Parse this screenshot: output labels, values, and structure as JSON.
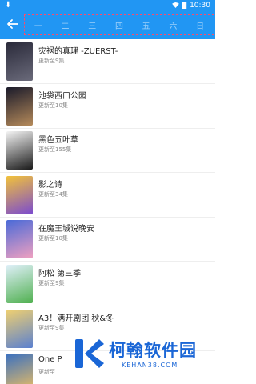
{
  "statusbar": {
    "time": "10:30"
  },
  "tabs": [
    "一",
    "二",
    "三",
    "四",
    "五",
    "六",
    "日"
  ],
  "list": [
    {
      "title": "灾祸的真理 -ZUERST-",
      "update": "更新至9集",
      "cover_colors": [
        "#2a2a3a",
        "#6a6a7a"
      ]
    },
    {
      "title": "池袋西口公园",
      "update": "更新至10集",
      "cover_colors": [
        "#1a1a2a",
        "#b58a5a"
      ]
    },
    {
      "title": "黑色五叶草",
      "update": "更新至155集",
      "cover_colors": [
        "#f4f4f4",
        "#1a1a1a"
      ]
    },
    {
      "title": "影之诗",
      "update": "更新至34集",
      "cover_colors": [
        "#f2c23a",
        "#7a4ad0"
      ]
    },
    {
      "title": "在魔王城说晚安",
      "update": "更新至10集",
      "cover_colors": [
        "#4a6ad8",
        "#f0a0c0"
      ]
    },
    {
      "title": "阿松 第三季",
      "update": "更新至9集",
      "cover_colors": [
        "#e0f0fa",
        "#50b050"
      ]
    },
    {
      "title": "A3！满开剧团 秋&冬",
      "update": "更新至9集",
      "cover_colors": [
        "#f0d070",
        "#5a80d0"
      ]
    },
    {
      "title": "One P",
      "update": "更新至",
      "cover_colors": [
        "#3a70c0",
        "#f0c060"
      ]
    }
  ],
  "watermark": {
    "name": "柯翰软件园",
    "url": "KEHAN38.COM"
  }
}
